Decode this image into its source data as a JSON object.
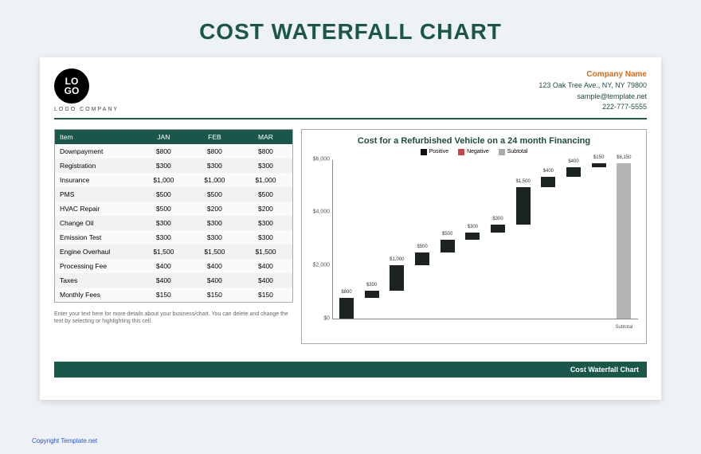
{
  "page_title": "COST WATERFALL CHART",
  "header": {
    "logo_line1": "LO",
    "logo_line2": "GO",
    "logo_sub": "LOGO COMPANY",
    "company_name": "Company Name",
    "address": "123 Oak Tree Ave., NY, NY 79800",
    "email": "sample@template.net",
    "phone": "222-777-5555"
  },
  "table": {
    "headers": [
      "Item",
      "JAN",
      "FEB",
      "MAR"
    ],
    "rows": [
      [
        "Downpayment",
        "$800",
        "$800",
        "$800"
      ],
      [
        "Registration",
        "$300",
        "$300",
        "$300"
      ],
      [
        "Insurance",
        "$1,000",
        "$1,000",
        "$1,000"
      ],
      [
        "PMS",
        "$500",
        "$500",
        "$500"
      ],
      [
        "HVAC Repair",
        "$500",
        "$200",
        "$200"
      ],
      [
        "Change Oil",
        "$300",
        "$300",
        "$300"
      ],
      [
        "Emission Test",
        "$300",
        "$300",
        "$300"
      ],
      [
        "Engine Overhaul",
        "$1,500",
        "$1,500",
        "$1,500"
      ],
      [
        "Processing Fee",
        "$400",
        "$400",
        "$400"
      ],
      [
        "Taxes",
        "$400",
        "$400",
        "$400"
      ],
      [
        "Monthly Fees",
        "$150",
        "$150",
        "$150"
      ]
    ]
  },
  "note": "Enter your text here for more details about your business/chart. You can delete and change the text by selecting or highlighting this cell.",
  "footer_bar": "Cost Waterfall Chart",
  "copyright": "Copyright Template.net",
  "chart_data": {
    "type": "waterfall",
    "title": "Cost for a Refurbished Vehicle on a 24 month Financing",
    "legend": [
      "Positive",
      "Negative",
      "Subtotal"
    ],
    "x": [
      "",
      "",
      "",
      "",
      "",
      "",
      "",
      "",
      "",
      "",
      "",
      "Subtotal"
    ],
    "values": [
      800,
      300,
      1000,
      500,
      500,
      300,
      300,
      1500,
      400,
      400,
      150,
      6150
    ],
    "labels": [
      "$800",
      "$300",
      "$1,000",
      "$500",
      "$500",
      "$300",
      "$300",
      "$1,500",
      "$400",
      "$400",
      "$150",
      "$6,150"
    ],
    "kinds": [
      "pos",
      "pos",
      "pos",
      "pos",
      "pos",
      "pos",
      "pos",
      "pos",
      "pos",
      "pos",
      "pos",
      "sub"
    ],
    "ylim": [
      0,
      6000
    ],
    "yticks": [
      0,
      2000,
      4000,
      6000
    ],
    "ytick_labels": [
      "$0",
      "$2,000",
      "$4,000",
      "$6,000"
    ]
  }
}
